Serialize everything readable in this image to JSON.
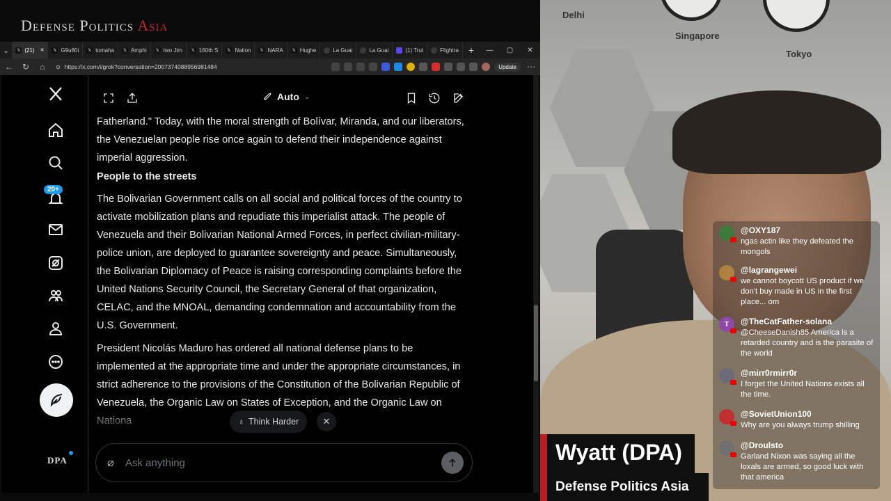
{
  "brand": {
    "main": "Defense Politics ",
    "accent": "Asia"
  },
  "browser": {
    "tabs": [
      {
        "label": "(21)",
        "icon": "x",
        "active": true
      },
      {
        "label": "G9u80i",
        "icon": "x"
      },
      {
        "label": "tomaha",
        "icon": "x"
      },
      {
        "label": "Amphi",
        "icon": "x"
      },
      {
        "label": "Iwo Jim",
        "icon": "x"
      },
      {
        "label": "160th S",
        "icon": "x"
      },
      {
        "label": "Nation",
        "icon": "x"
      },
      {
        "label": "NARA",
        "icon": "x"
      },
      {
        "label": "Hughe",
        "icon": "x"
      },
      {
        "label": "La Guai",
        "icon": "globe"
      },
      {
        "label": "La Guai",
        "icon": "globe"
      },
      {
        "label": "(1) Trut",
        "icon": "truth"
      },
      {
        "label": "Flightra",
        "icon": "globe"
      }
    ],
    "url": "https://x.com/i/grok?conversation=2007374088956981484",
    "update_label": "Update"
  },
  "x": {
    "notifications_badge": "20+",
    "mode_label": "Auto",
    "paragraphs": {
      "p1": "Fatherland.\" Today, with the moral strength of Bolívar, Miranda, and our liberators, the Venezuelan people rise once again to defend their independence against imperial aggression.",
      "h1": "People to the streets",
      "p2": "The Bolivarian Government calls on all social and political forces of the country to activate mobilization plans and repudiate this imperialist attack. The people of Venezuela and their Bolivarian National Armed Forces, in perfect civilian-military-police union, are deployed to guarantee sovereignty and peace. Simultaneously, the Bolivarian Diplomacy of Peace is raising corresponding complaints before the United Nations Security Council, the Secretary General of that organization, CELAC, and the MNOAL, demanding condemnation and accountability from the U.S. Government.",
      "p3": "President Nicolás Maduro has ordered all national defense plans to be implemented at the appropriate time and under the appropriate circumstances, in strict adherence to the provisions of the Constitution of the Bolivarian Republic of Venezuela, the Organic Law on States of Exception, and the Organic Law on Nationa"
    },
    "think_harder_label": "Think Harder",
    "composer_placeholder": "Ask anything",
    "logo_text": "DPA"
  },
  "clocks": {
    "delhi": "Delhi",
    "singapore": "Singapore",
    "tokyo": "Tokyo"
  },
  "chat": [
    {
      "user": "@OXY187",
      "text": "ngas actin like they defeated the mongols",
      "avatar_color": "#3c7a3c",
      "initial": ""
    },
    {
      "user": "@lagrangewei",
      "text": "we cannot boycott US product if we don't buy made in US in the first place... om",
      "avatar_color": "#b08040",
      "initial": ""
    },
    {
      "user": "@TheCatFather-solana",
      "text": "@CheeseDanish85 America is a retarded country and is the parasite of the world",
      "avatar_color": "#8e4aa8",
      "initial": "T"
    },
    {
      "user": "@mirr0rmirr0r",
      "text": "I forget the United Nations exists all the time.",
      "avatar_color": "#6a6a7a",
      "initial": ""
    },
    {
      "user": "@SovietUnion100",
      "text": "Why are you always trump shilling",
      "avatar_color": "#c03030",
      "initial": ""
    },
    {
      "user": "@Droulsto",
      "text": "Garland Nixon was saying all the loxals are armed, so good luck with that america",
      "avatar_color": "#707070",
      "initial": ""
    }
  ],
  "lower_third": {
    "name": "Wyatt (DPA)",
    "subtitle": "Defense Politics Asia",
    "accent_color": "#b41f24"
  }
}
